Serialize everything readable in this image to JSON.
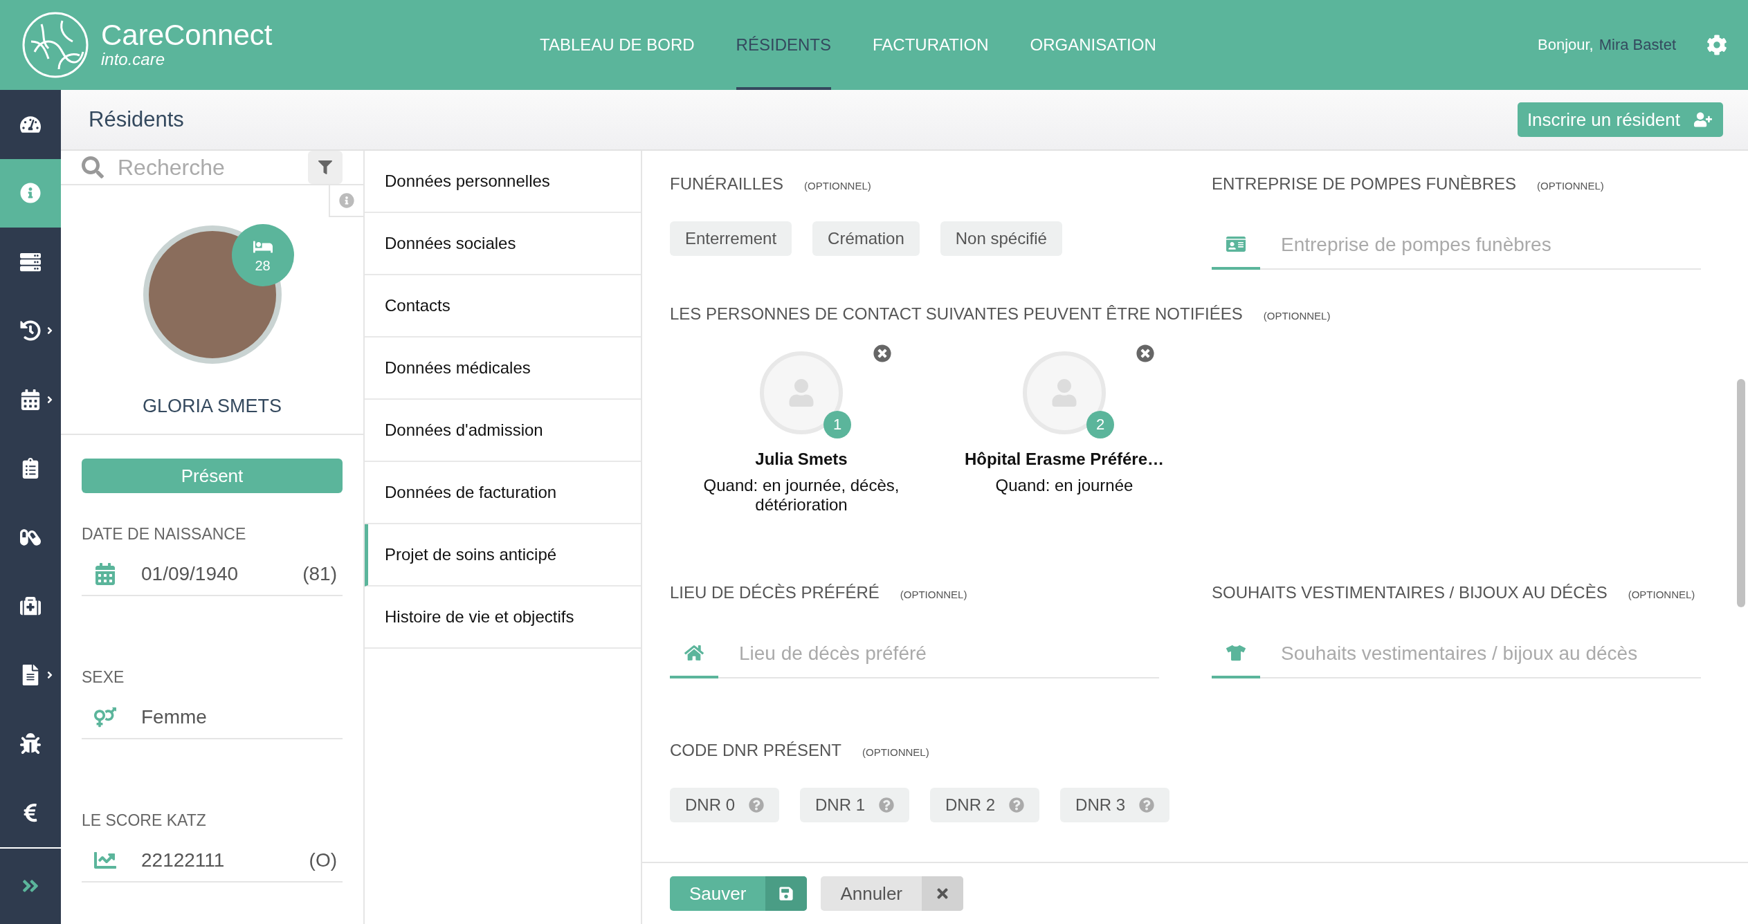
{
  "header": {
    "logo_title": "CareConnect",
    "logo_subtitle": "into.care",
    "nav": [
      {
        "label": "TABLEAU DE BORD",
        "selected": false
      },
      {
        "label": "RÉSIDENTS",
        "selected": true
      },
      {
        "label": "FACTURATION",
        "selected": false
      },
      {
        "label": "ORGANISATION",
        "selected": false
      }
    ],
    "greeting": "Bonjour,",
    "user": "Mira Bastet"
  },
  "sidebar": {
    "items": [
      {
        "selected": false,
        "submenu": false
      },
      {
        "selected": true,
        "submenu": false
      },
      {
        "selected": false,
        "submenu": false
      },
      {
        "selected": false,
        "submenu": true
      },
      {
        "selected": false,
        "submenu": true
      },
      {
        "selected": false,
        "submenu": false
      },
      {
        "selected": false,
        "submenu": false
      },
      {
        "selected": false,
        "submenu": false
      },
      {
        "selected": false,
        "submenu": true
      },
      {
        "selected": false,
        "submenu": false
      },
      {
        "selected": false,
        "submenu": false
      }
    ]
  },
  "page": {
    "title": "Résidents",
    "action": "Inscrire un résident"
  },
  "resident": {
    "search_placeholder": "Recherche",
    "bed": "28",
    "name": "GLORIA SMETS",
    "status": "Présent",
    "fields": [
      {
        "kind": "date",
        "label": "DATE DE NAISSANCE",
        "value": "01/09/1940",
        "extra": "(81)"
      },
      {
        "kind": "gender",
        "label": "SEXE",
        "value": "Femme"
      },
      {
        "kind": "score",
        "label": "LE SCORE KATZ",
        "value": "22122111",
        "extra": "(O)"
      }
    ]
  },
  "sections": [
    {
      "label": "Données personnelles",
      "selected": false
    },
    {
      "label": "Données sociales",
      "selected": false
    },
    {
      "label": "Contacts",
      "selected": false
    },
    {
      "label": "Données médicales",
      "selected": false
    },
    {
      "label": "Données d'admission",
      "selected": false
    },
    {
      "label": "Données de facturation",
      "selected": false
    },
    {
      "label": "Projet de soins anticipé",
      "selected": true
    },
    {
      "label": "Histoire de vie et objectifs",
      "selected": false
    }
  ],
  "form": {
    "funeral": {
      "label": "FUNÉRAILLES",
      "optional": "(OPTIONNEL)",
      "options": [
        {
          "label": "Enterrement",
          "selected": false
        },
        {
          "label": "Crémation",
          "selected": false
        },
        {
          "label": "Non spécifié",
          "selected": false
        }
      ]
    },
    "undertaker": {
      "label": "ENTREPRISE DE POMPES FUNÈBRES",
      "optional": "(OPTIONNEL)",
      "placeholder": "Entreprise de pompes funèbres"
    },
    "contacts": {
      "label": "LES PERSONNES DE CONTACT SUIVANTES PEUVENT ÊTRE NOTIFIÉES",
      "optional": "(OPTIONNEL)",
      "people": [
        {
          "number": "1",
          "name": "Julia Smets",
          "when": "Quand: en journée, décès, détérioration"
        },
        {
          "number": "2",
          "name": "Hôpital Erasme Préfére…",
          "when": "Quand: en journée"
        }
      ]
    },
    "place": {
      "label": "LIEU DE DÉCÈS PRÉFÉRÉ",
      "optional": "(OPTIONNEL)",
      "placeholder": "Lieu de décès préféré"
    },
    "clothing": {
      "label": "SOUHAITS VESTIMENTAIRES / BIJOUX AU DÉCÈS",
      "optional": "(OPTIONNEL)",
      "placeholder": "Souhaits vestimentaires / bijoux au décès"
    },
    "dnr": {
      "label": "CODE DNR PRÉSENT",
      "optional": "(OPTIONNEL)",
      "options": [
        {
          "label": "DNR 0",
          "selected": false
        },
        {
          "label": "DNR 1",
          "selected": false
        },
        {
          "label": "DNR 2",
          "selected": false
        },
        {
          "label": "DNR 3",
          "selected": false
        }
      ]
    }
  },
  "actions": {
    "save": "Sauver",
    "cancel": "Annuler"
  }
}
